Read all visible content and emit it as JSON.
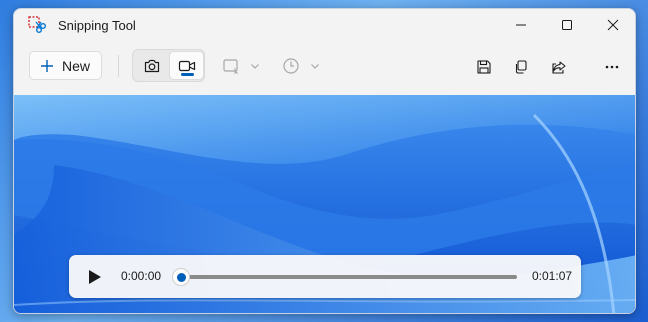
{
  "window": {
    "title": "Snipping Tool"
  },
  "toolbar": {
    "new_label": "New",
    "modes": [
      {
        "name": "snip-mode",
        "icon": "camera-icon",
        "active": false
      },
      {
        "name": "record-mode",
        "icon": "video-icon",
        "active": true
      }
    ],
    "shape_dropdown": {
      "icon": "rectangle-snip-icon"
    },
    "delay_dropdown": {
      "icon": "clock-icon"
    },
    "actions": [
      "save-icon",
      "copy-icon",
      "share-icon",
      "more-icon"
    ]
  },
  "player": {
    "current_time": "0:00:00",
    "total_time": "0:01:07",
    "progress": 0
  },
  "colors": {
    "accent": "#005fb8",
    "window_bg": "#f3f3f3"
  }
}
